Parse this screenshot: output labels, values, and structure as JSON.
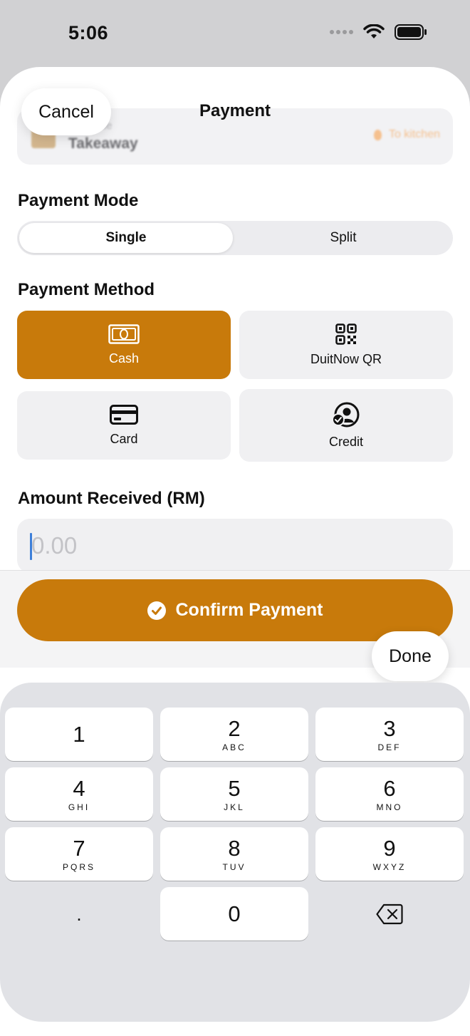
{
  "status_bar": {
    "time": "5:06"
  },
  "header": {
    "title": "Payment",
    "cancel_label": "Cancel"
  },
  "order_card": {
    "mode_label": "Mode",
    "mode_value": "Takeaway",
    "kitchen_label": "To kitchen"
  },
  "payment_mode": {
    "label": "Payment Mode",
    "options": [
      "Single",
      "Split"
    ],
    "selected": "Single"
  },
  "payment_method": {
    "label": "Payment Method",
    "methods": [
      {
        "label": "Cash",
        "icon": "cash-icon",
        "selected": true
      },
      {
        "label": "DuitNow QR",
        "icon": "qr-code-icon",
        "selected": false
      },
      {
        "label": "Card",
        "icon": "credit-card-icon",
        "selected": false
      },
      {
        "label": "Credit",
        "icon": "person-check-icon",
        "selected": false
      }
    ]
  },
  "amount": {
    "label": "Amount Received (RM)",
    "placeholder": "0.00",
    "value": ""
  },
  "confirm": {
    "label": "Confirm Payment"
  },
  "keyboard": {
    "done_label": "Done",
    "keys": [
      {
        "digit": "1",
        "letters": ""
      },
      {
        "digit": "2",
        "letters": "ABC"
      },
      {
        "digit": "3",
        "letters": "DEF"
      },
      {
        "digit": "4",
        "letters": "GHI"
      },
      {
        "digit": "5",
        "letters": "JKL"
      },
      {
        "digit": "6",
        "letters": "MNO"
      },
      {
        "digit": "7",
        "letters": "PQRS"
      },
      {
        "digit": "8",
        "letters": "TUV"
      },
      {
        "digit": "9",
        "letters": "WXYZ"
      },
      {
        "digit": ".",
        "letters": ""
      },
      {
        "digit": "0",
        "letters": ""
      }
    ]
  },
  "colors": {
    "accent": "#c87a0b",
    "tile_bg": "#f0f0f2",
    "keyboard_bg": "#e1e2e6"
  }
}
